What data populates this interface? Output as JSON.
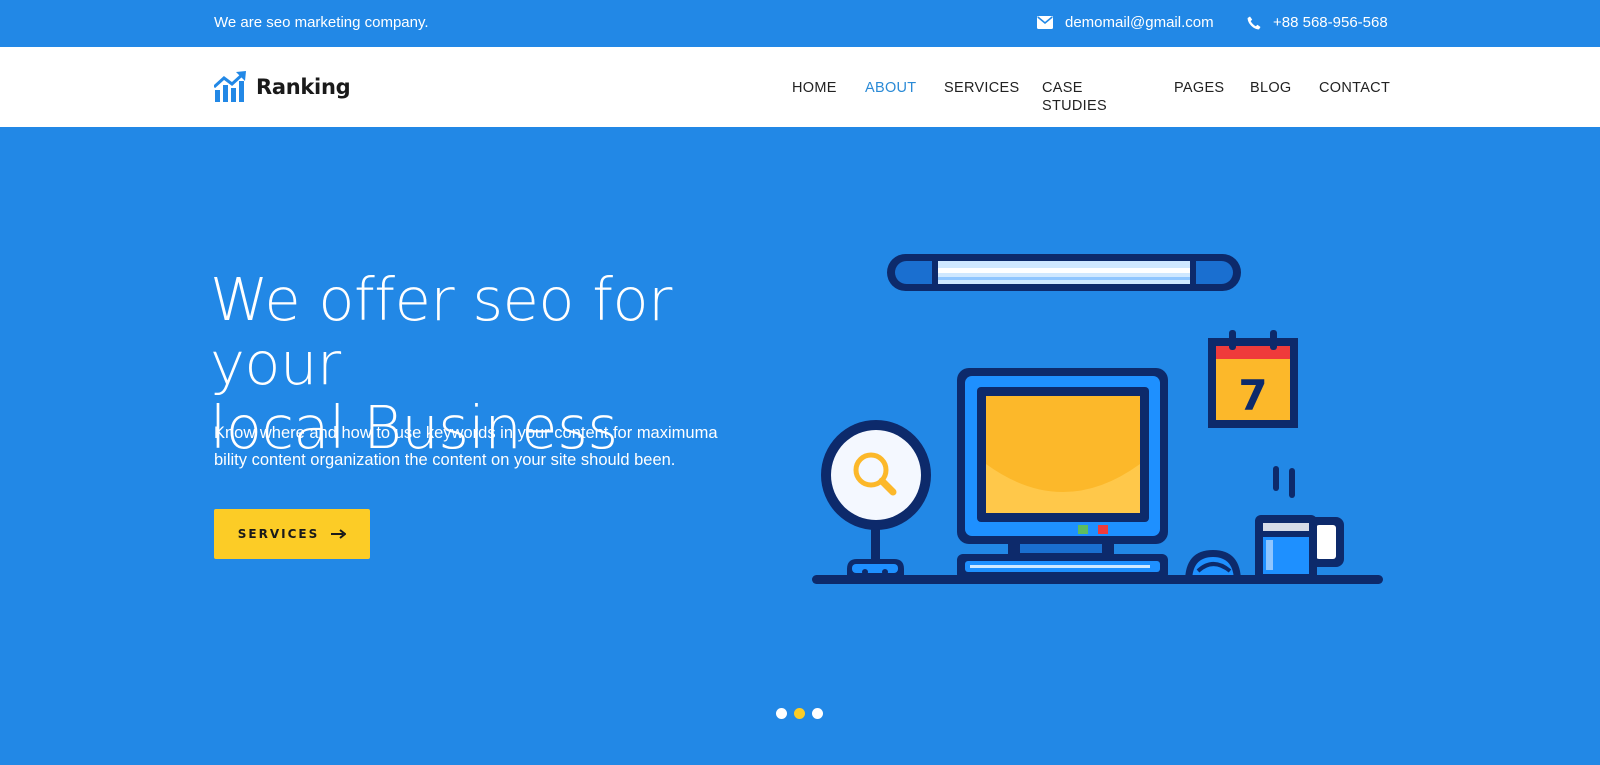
{
  "topbar": {
    "tagline": "We are seo marketing company.",
    "email": "demomail@gmail.com",
    "phone": "+88 568-956-568"
  },
  "brand": {
    "name": "Ranking",
    "icon": "chart-trend-icon",
    "color": "#2288e6"
  },
  "nav": {
    "items": [
      {
        "label": "HOME",
        "active": false
      },
      {
        "label": "ABOUT",
        "active": true
      },
      {
        "label": "SERVICES",
        "active": false
      },
      {
        "label": "CASE STUDIES",
        "active": false
      },
      {
        "label": "PAGES",
        "active": false
      },
      {
        "label": "BLOG",
        "active": false
      },
      {
        "label": "CONTACT",
        "active": false
      }
    ],
    "active_color": "#2a8ad6"
  },
  "hero": {
    "title_line1": "We offer seo for your",
    "title_line2": "local Business",
    "description": "Know where and how to use keywords in your content for maximuma bility content organization the content on your site should been.",
    "button_label": "SERVICES",
    "button_color": "#fccc26",
    "calendar_day": "7"
  },
  "slider": {
    "slide_count": 3,
    "active_index": 1
  },
  "colors": {
    "background": "#2288e6",
    "accent": "#fccc26",
    "dark_navy": "#0d2a6b"
  }
}
